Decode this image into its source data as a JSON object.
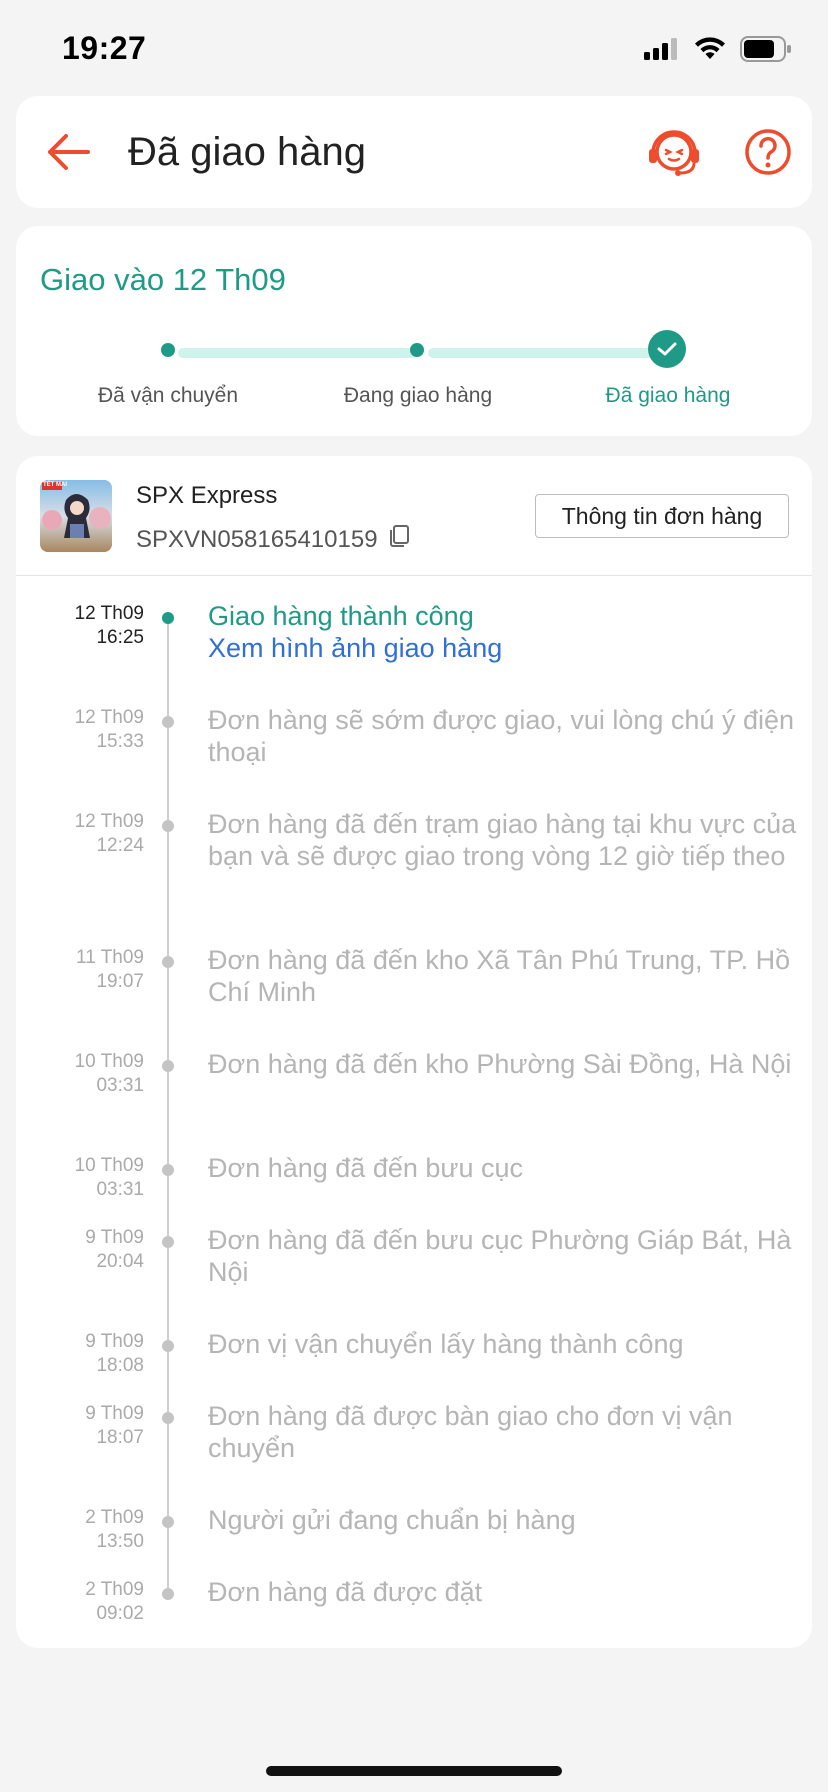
{
  "status_bar": {
    "time": "19:27"
  },
  "header": {
    "title": "Đã giao hàng"
  },
  "progress": {
    "title": "Giao vào 12 Th09",
    "steps": [
      "Đã vận chuyển",
      "Đang giao hàng",
      "Đã giao hàng"
    ]
  },
  "shipment": {
    "carrier": "SPX Express",
    "tracking_number": "SPXVN058165410159",
    "order_info_label": "Thông tin đơn hàng",
    "thumb_badge": "TẾT MAI"
  },
  "timeline": [
    {
      "date": "12 Th09",
      "time": "16:25",
      "status": "Giao hàng thành công",
      "link": "Xem hình ảnh giao hàng"
    },
    {
      "date": "12 Th09",
      "time": "15:33",
      "text": "Đơn hàng sẽ sớm được giao, vui lòng chú ý điện thoại"
    },
    {
      "date": "12 Th09",
      "time": "12:24",
      "text": "Đơn hàng đã đến trạm giao hàng tại khu vực của bạn  và sẽ được giao trong vòng 12 giờ tiếp theo"
    },
    {
      "date": "11 Th09",
      "time": "19:07",
      "text": "Đơn hàng đã đến kho Xã Tân Phú Trung, TP. Hồ Chí Minh"
    },
    {
      "date": "10 Th09",
      "time": "03:31",
      "text": "Đơn hàng đã đến kho Phường Sài Đồng, Hà Nội"
    },
    {
      "date": "10 Th09",
      "time": "03:31",
      "text": "Đơn hàng đã đến bưu cục"
    },
    {
      "date": "9 Th09",
      "time": "20:04",
      "text": "Đơn hàng đã đến bưu cục Phường Giáp Bát, Hà Nội"
    },
    {
      "date": "9 Th09",
      "time": "18:08",
      "text": "Đơn vị vận chuyển lấy hàng thành công"
    },
    {
      "date": "9 Th09",
      "time": "18:07",
      "text": "Đơn hàng đã được bàn giao cho đơn vị vận chuyển"
    },
    {
      "date": "2 Th09",
      "time": "13:50",
      "text": "Người gửi đang chuẩn bị hàng"
    },
    {
      "date": "2 Th09",
      "time": "09:02",
      "text": "Đơn hàng đã được đặt"
    }
  ],
  "icons": {
    "back": "arrow-left-icon",
    "support": "headset-agent-icon",
    "help": "question-circle-icon",
    "copy": "copy-icon",
    "check": "check-icon"
  },
  "colors": {
    "accent": "#ee4d2d",
    "success": "#1f9a86",
    "link": "#2f6fd6",
    "muted": "#b5b5b5"
  }
}
